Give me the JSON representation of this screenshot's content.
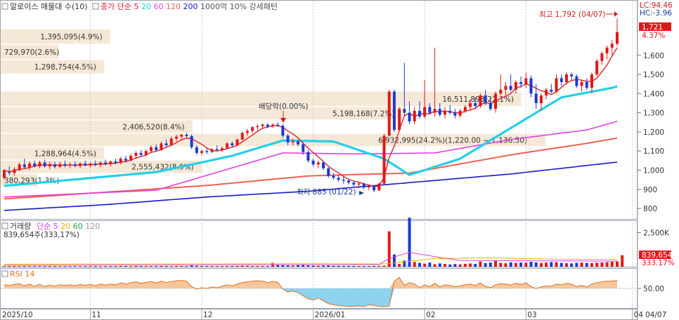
{
  "header": {
    "main_title": "알로이스 매물대 수(10)",
    "main_legend": [
      {
        "text": "종가 단순 5",
        "color": "#e0202a"
      },
      {
        "text": "20",
        "color": "#22d0e8"
      },
      {
        "text": "60",
        "color": "#e040e0"
      },
      {
        "text": "120",
        "color": "#f06050"
      },
      {
        "text": "200",
        "color": "#1818c8"
      },
      {
        "text": "1000억 10% 강세패턴",
        "color": "#555555"
      }
    ],
    "volume_title": "거래량",
    "volume_legend": [
      {
        "text": "단순 5",
        "color": "#e040e0"
      },
      {
        "text": "20",
        "color": "#e8b400"
      },
      {
        "text": "60",
        "color": "#22a040"
      },
      {
        "text": "120",
        "color": "#999999"
      }
    ],
    "volume_value": "839,654주(333,17%)",
    "rsi_title": "RSI 14"
  },
  "right_labels": {
    "lc": "LC:94.46",
    "hc": "HC:-3.96",
    "price_box": "1,721",
    "price_pct": "4.37%",
    "vol_box": "839,654",
    "vol_pct": "333.17%"
  },
  "annotations": {
    "high": "최고 1,792 (04/07)",
    "low": "최저 885 (01/22)",
    "dividend": "배당락(0.00%)"
  },
  "volume_profile": [
    {
      "label": "1,395,095(4.9%)",
      "lo": 1660,
      "hi": 1735,
      "frac": 0.18
    },
    {
      "label": "729,970(2.6%)",
      "lo": 1580,
      "hi": 1655,
      "frac": 0.095
    },
    {
      "label": "1,298,754(4.5%)",
      "lo": 1505,
      "hi": 1575,
      "frac": 0.17
    },
    {
      "label": "16,511,893(22.1%)",
      "lo": 1335,
      "hi": 1410,
      "frac": 0.855
    },
    {
      "label": "5,198,168(7.2%)",
      "lo": 1265,
      "hi": 1330,
      "frac": 0.66
    },
    {
      "label": "2,406,520(8.4%)",
      "lo": 1195,
      "hi": 1260,
      "frac": 0.315
    },
    {
      "label": "6,932,995(24.2%)(1,220.00 ~ 1,136.50)",
      "lo": 1125,
      "hi": 1190,
      "frac": 0.895
    },
    {
      "label": "1,288,964(4.5%)",
      "lo": 1055,
      "hi": 1120,
      "frac": 0.17
    },
    {
      "label": "2,555,432(8.9%)",
      "lo": 985,
      "hi": 1050,
      "frac": 0.33
    },
    {
      "label": "380,293(1.3%)",
      "lo": 915,
      "hi": 980,
      "frac": 0.06
    }
  ],
  "chart_data": {
    "type": "candlestick",
    "price_axis": {
      "ticks": [
        800,
        900,
        1000,
        1100,
        1200,
        1300,
        1400,
        1500,
        1600
      ],
      "labels": [
        "800",
        "900",
        "1,000",
        "1,100",
        "1,200",
        "1,300",
        "1,400",
        "1,500",
        "1,600"
      ],
      "range": [
        760,
        1830
      ]
    },
    "volume_axis": {
      "ticks": [
        2500000
      ],
      "labels": [
        "2,500K"
      ],
      "range": [
        0,
        3200000
      ]
    },
    "rsi_axis": {
      "ticks": [
        50
      ],
      "labels": [
        "50.00"
      ],
      "range": [
        0,
        100
      ]
    },
    "x_labels": [
      {
        "i": 0,
        "label": "2025/10"
      },
      {
        "i": 17,
        "label": "11"
      },
      {
        "i": 39,
        "label": "12"
      },
      {
        "i": 61,
        "label": "2026/01"
      },
      {
        "i": 83,
        "label": "02"
      },
      {
        "i": 103,
        "label": "03"
      },
      {
        "i": 124,
        "label": "04"
      }
    ],
    "last_x_label": "04/07",
    "candles": [
      {
        "o": 960,
        "h": 1005,
        "l": 950,
        "c": 1000
      },
      {
        "o": 990,
        "h": 1020,
        "l": 975,
        "c": 985
      },
      {
        "o": 985,
        "h": 1015,
        "l": 970,
        "c": 1005
      },
      {
        "o": 1000,
        "h": 1040,
        "l": 995,
        "c": 1030
      },
      {
        "o": 1030,
        "h": 1060,
        "l": 1010,
        "c": 1015
      },
      {
        "o": 1015,
        "h": 1045,
        "l": 1000,
        "c": 1035
      },
      {
        "o": 1035,
        "h": 1050,
        "l": 1015,
        "c": 1020
      },
      {
        "o": 1020,
        "h": 1050,
        "l": 1010,
        "c": 1040
      },
      {
        "o": 1040,
        "h": 1055,
        "l": 1015,
        "c": 1020
      },
      {
        "o": 1020,
        "h": 1045,
        "l": 1005,
        "c": 1030
      },
      {
        "o": 1030,
        "h": 1045,
        "l": 1010,
        "c": 1018
      },
      {
        "o": 1018,
        "h": 1045,
        "l": 1010,
        "c": 1032
      },
      {
        "o": 1032,
        "h": 1050,
        "l": 1015,
        "c": 1025
      },
      {
        "o": 1025,
        "h": 1040,
        "l": 1010,
        "c": 1030
      },
      {
        "o": 1030,
        "h": 1045,
        "l": 1015,
        "c": 1022
      },
      {
        "o": 1022,
        "h": 1040,
        "l": 1010,
        "c": 1035
      },
      {
        "o": 1035,
        "h": 1050,
        "l": 1020,
        "c": 1025
      },
      {
        "o": 1025,
        "h": 1040,
        "l": 1015,
        "c": 1035
      },
      {
        "o": 1035,
        "h": 1050,
        "l": 1020,
        "c": 1028
      },
      {
        "o": 1028,
        "h": 1045,
        "l": 1015,
        "c": 1040
      },
      {
        "o": 1040,
        "h": 1055,
        "l": 1025,
        "c": 1032
      },
      {
        "o": 1032,
        "h": 1050,
        "l": 1020,
        "c": 1045
      },
      {
        "o": 1045,
        "h": 1060,
        "l": 1030,
        "c": 1038
      },
      {
        "o": 1038,
        "h": 1070,
        "l": 1030,
        "c": 1060
      },
      {
        "o": 1060,
        "h": 1075,
        "l": 1040,
        "c": 1050
      },
      {
        "o": 1050,
        "h": 1085,
        "l": 1045,
        "c": 1075
      },
      {
        "o": 1075,
        "h": 1100,
        "l": 1060,
        "c": 1090
      },
      {
        "o": 1090,
        "h": 1105,
        "l": 1070,
        "c": 1080
      },
      {
        "o": 1080,
        "h": 1110,
        "l": 1070,
        "c": 1100
      },
      {
        "o": 1100,
        "h": 1130,
        "l": 1090,
        "c": 1120
      },
      {
        "o": 1120,
        "h": 1135,
        "l": 1095,
        "c": 1105
      },
      {
        "o": 1105,
        "h": 1150,
        "l": 1100,
        "c": 1140
      },
      {
        "o": 1140,
        "h": 1160,
        "l": 1120,
        "c": 1130
      },
      {
        "o": 1130,
        "h": 1175,
        "l": 1125,
        "c": 1165
      },
      {
        "o": 1165,
        "h": 1185,
        "l": 1150,
        "c": 1175
      },
      {
        "o": 1175,
        "h": 1190,
        "l": 1160,
        "c": 1185
      },
      {
        "o": 1185,
        "h": 1195,
        "l": 1170,
        "c": 1178
      },
      {
        "o": 1178,
        "h": 1188,
        "l": 1110,
        "c": 1120
      },
      {
        "o": 1120,
        "h": 1130,
        "l": 1080,
        "c": 1090
      },
      {
        "o": 1090,
        "h": 1110,
        "l": 1080,
        "c": 1100
      },
      {
        "o": 1100,
        "h": 1115,
        "l": 1085,
        "c": 1095
      },
      {
        "o": 1095,
        "h": 1115,
        "l": 1090,
        "c": 1110
      },
      {
        "o": 1110,
        "h": 1130,
        "l": 1100,
        "c": 1105
      },
      {
        "o": 1105,
        "h": 1125,
        "l": 1095,
        "c": 1115
      },
      {
        "o": 1115,
        "h": 1145,
        "l": 1110,
        "c": 1140
      },
      {
        "o": 1140,
        "h": 1150,
        "l": 1120,
        "c": 1130
      },
      {
        "o": 1130,
        "h": 1165,
        "l": 1125,
        "c": 1160
      },
      {
        "o": 1160,
        "h": 1200,
        "l": 1155,
        "c": 1195
      },
      {
        "o": 1195,
        "h": 1215,
        "l": 1180,
        "c": 1205
      },
      {
        "o": 1205,
        "h": 1230,
        "l": 1195,
        "c": 1225
      },
      {
        "o": 1225,
        "h": 1240,
        "l": 1210,
        "c": 1230
      },
      {
        "o": 1230,
        "h": 1245,
        "l": 1215,
        "c": 1238
      },
      {
        "o": 1238,
        "h": 1245,
        "l": 1220,
        "c": 1228
      },
      {
        "o": 1228,
        "h": 1245,
        "l": 1220,
        "c": 1238
      },
      {
        "o": 1238,
        "h": 1250,
        "l": 1225,
        "c": 1232
      },
      {
        "o": 1232,
        "h": 1240,
        "l": 1170,
        "c": 1180
      },
      {
        "o": 1180,
        "h": 1190,
        "l": 1130,
        "c": 1145
      },
      {
        "o": 1145,
        "h": 1165,
        "l": 1130,
        "c": 1150
      },
      {
        "o": 1150,
        "h": 1160,
        "l": 1125,
        "c": 1135
      },
      {
        "o": 1135,
        "h": 1145,
        "l": 1080,
        "c": 1095
      },
      {
        "o": 1095,
        "h": 1105,
        "l": 1040,
        "c": 1050
      },
      {
        "o": 1050,
        "h": 1060,
        "l": 1020,
        "c": 1030
      },
      {
        "o": 1030,
        "h": 1050,
        "l": 1010,
        "c": 1040
      },
      {
        "o": 1040,
        "h": 1045,
        "l": 1000,
        "c": 1010
      },
      {
        "o": 1010,
        "h": 1015,
        "l": 960,
        "c": 970
      },
      {
        "o": 970,
        "h": 985,
        "l": 950,
        "c": 960
      },
      {
        "o": 960,
        "h": 975,
        "l": 940,
        "c": 950
      },
      {
        "o": 950,
        "h": 965,
        "l": 930,
        "c": 945
      },
      {
        "o": 945,
        "h": 955,
        "l": 925,
        "c": 935
      },
      {
        "o": 935,
        "h": 945,
        "l": 915,
        "c": 925
      },
      {
        "o": 925,
        "h": 940,
        "l": 905,
        "c": 930
      },
      {
        "o": 930,
        "h": 935,
        "l": 900,
        "c": 910
      },
      {
        "o": 910,
        "h": 925,
        "l": 895,
        "c": 915
      },
      {
        "o": 915,
        "h": 920,
        "l": 885,
        "c": 895
      },
      {
        "o": 895,
        "h": 935,
        "l": 890,
        "c": 930
      },
      {
        "o": 930,
        "h": 1190,
        "l": 925,
        "c": 1180
      },
      {
        "o": 1180,
        "h": 1420,
        "l": 1175,
        "c": 1410
      },
      {
        "o": 1410,
        "h": 1420,
        "l": 1200,
        "c": 1210
      },
      {
        "o": 1210,
        "h": 1330,
        "l": 1200,
        "c": 1320
      },
      {
        "o": 1320,
        "h": 1560,
        "l": 1280,
        "c": 1300
      },
      {
        "o": 1300,
        "h": 1360,
        "l": 1240,
        "c": 1255
      },
      {
        "o": 1255,
        "h": 1330,
        "l": 1240,
        "c": 1310
      },
      {
        "o": 1310,
        "h": 1360,
        "l": 1270,
        "c": 1280
      },
      {
        "o": 1280,
        "h": 1470,
        "l": 1270,
        "c": 1330
      },
      {
        "o": 1330,
        "h": 1350,
        "l": 1290,
        "c": 1300
      },
      {
        "o": 1300,
        "h": 1640,
        "l": 1280,
        "c": 1320
      },
      {
        "o": 1320,
        "h": 1350,
        "l": 1280,
        "c": 1290
      },
      {
        "o": 1290,
        "h": 1330,
        "l": 1270,
        "c": 1310
      },
      {
        "o": 1310,
        "h": 1340,
        "l": 1290,
        "c": 1300
      },
      {
        "o": 1300,
        "h": 1320,
        "l": 1270,
        "c": 1285
      },
      {
        "o": 1285,
        "h": 1320,
        "l": 1275,
        "c": 1310
      },
      {
        "o": 1310,
        "h": 1340,
        "l": 1300,
        "c": 1330
      },
      {
        "o": 1330,
        "h": 1370,
        "l": 1310,
        "c": 1350
      },
      {
        "o": 1350,
        "h": 1380,
        "l": 1320,
        "c": 1335
      },
      {
        "o": 1335,
        "h": 1400,
        "l": 1325,
        "c": 1390
      },
      {
        "o": 1390,
        "h": 1420,
        "l": 1340,
        "c": 1350
      },
      {
        "o": 1350,
        "h": 1380,
        "l": 1310,
        "c": 1320
      },
      {
        "o": 1320,
        "h": 1410,
        "l": 1300,
        "c": 1400
      },
      {
        "o": 1400,
        "h": 1500,
        "l": 1390,
        "c": 1420
      },
      {
        "o": 1420,
        "h": 1460,
        "l": 1390,
        "c": 1440
      },
      {
        "o": 1440,
        "h": 1500,
        "l": 1410,
        "c": 1420
      },
      {
        "o": 1420,
        "h": 1470,
        "l": 1400,
        "c": 1460
      },
      {
        "o": 1460,
        "h": 1490,
        "l": 1430,
        "c": 1450
      },
      {
        "o": 1450,
        "h": 1510,
        "l": 1430,
        "c": 1480
      },
      {
        "o": 1480,
        "h": 1495,
        "l": 1380,
        "c": 1400
      },
      {
        "o": 1400,
        "h": 1450,
        "l": 1320,
        "c": 1350
      },
      {
        "o": 1350,
        "h": 1400,
        "l": 1310,
        "c": 1390
      },
      {
        "o": 1390,
        "h": 1430,
        "l": 1370,
        "c": 1420
      },
      {
        "o": 1420,
        "h": 1450,
        "l": 1400,
        "c": 1410
      },
      {
        "o": 1410,
        "h": 1500,
        "l": 1400,
        "c": 1480
      },
      {
        "o": 1480,
        "h": 1500,
        "l": 1440,
        "c": 1460
      },
      {
        "o": 1460,
        "h": 1510,
        "l": 1450,
        "c": 1500
      },
      {
        "o": 1500,
        "h": 1510,
        "l": 1470,
        "c": 1490
      },
      {
        "o": 1490,
        "h": 1500,
        "l": 1430,
        "c": 1440
      },
      {
        "o": 1440,
        "h": 1470,
        "l": 1410,
        "c": 1460
      },
      {
        "o": 1460,
        "h": 1480,
        "l": 1420,
        "c": 1430
      },
      {
        "o": 1430,
        "h": 1510,
        "l": 1400,
        "c": 1500
      },
      {
        "o": 1500,
        "h": 1580,
        "l": 1490,
        "c": 1570
      },
      {
        "o": 1570,
        "h": 1620,
        "l": 1550,
        "c": 1610
      },
      {
        "o": 1610,
        "h": 1650,
        "l": 1580,
        "c": 1640
      },
      {
        "o": 1640,
        "h": 1680,
        "l": 1600,
        "c": 1660
      },
      {
        "o": 1660,
        "h": 1792,
        "l": 1650,
        "c": 1721
      }
    ],
    "ma5_color": "#e0202a",
    "ma20": {
      "color": "#22d0e8",
      "x": [
        0,
        30,
        45,
        55,
        65,
        75,
        80,
        90,
        100,
        110,
        120,
        127
      ],
      "y": [
        918,
        990,
        1075,
        1155,
        1150,
        1060,
        975,
        1060,
        1220,
        1380,
        1430,
        1485
      ]
    },
    "ma60": {
      "color": "#e040e0",
      "x": [
        0,
        30,
        55,
        70,
        85,
        100,
        115,
        127
      ],
      "y": [
        860,
        895,
        1090,
        1085,
        1090,
        1160,
        1210,
        1300
      ]
    },
    "ma120": {
      "color": "#f06050",
      "x": [
        0,
        40,
        60,
        80,
        100,
        115,
        127
      ],
      "y": [
        850,
        920,
        970,
        985,
        1080,
        1140,
        1195
      ]
    },
    "ma200": {
      "color": "#1818c8",
      "x": [
        0,
        20,
        40,
        60,
        80,
        100,
        127
      ],
      "y": [
        790,
        820,
        860,
        890,
        935,
        980,
        1060
      ]
    },
    "volume": [
      38000,
      32000,
      40000,
      35000,
      30000,
      36000,
      34000,
      38000,
      32000,
      35000,
      30000,
      33000,
      29000,
      34000,
      31000,
      36000,
      30000,
      33000,
      37000,
      34000,
      32000,
      36000,
      35000,
      52000,
      42000,
      38000,
      60000,
      45000,
      40000,
      48000,
      42000,
      55000,
      44000,
      40000,
      50000,
      48000,
      42000,
      90000,
      62000,
      45000,
      40000,
      43000,
      38000,
      41000,
      50000,
      45000,
      55000,
      70000,
      65000,
      52000,
      48000,
      45000,
      42000,
      280000,
      160000,
      120000,
      95000,
      80000,
      110000,
      130000,
      95000,
      80000,
      72000,
      86000,
      90000,
      70000,
      64000,
      60000,
      58000,
      54000,
      50000,
      48000,
      45000,
      52000,
      55000,
      75000,
      2600000,
      900000,
      200000,
      450000,
      3600000,
      350000,
      280000,
      220000,
      300000,
      180000,
      240000,
      200000,
      160000,
      190000,
      170000,
      210000,
      230000,
      200000,
      380000,
      260000,
      300000,
      420000,
      280000,
      250000,
      320000,
      280000,
      300000,
      290000,
      360000,
      310000,
      270000,
      300000,
      340000,
      330000,
      280000,
      260000,
      240000,
      280000,
      300000,
      270000,
      260000,
      290000,
      310000,
      330000,
      360000,
      380000,
      839654
    ],
    "volume_ma5": {
      "color": "#e040e0",
      "x": [
        0,
        74,
        76,
        80,
        84,
        90,
        127
      ],
      "y": [
        100000,
        150000,
        600000,
        1050000,
        800000,
        450000,
        400000
      ]
    },
    "volume_ma20": {
      "color": "#e8b400",
      "x": [
        0,
        60,
        75,
        85,
        95,
        110,
        127
      ],
      "y": [
        180000,
        220000,
        200000,
        600000,
        650000,
        550000,
        520000
      ]
    },
    "rsi": [
      60,
      58,
      61,
      63,
      57,
      62,
      56,
      61,
      55,
      59,
      56,
      60,
      58,
      60,
      57,
      61,
      58,
      61,
      57,
      62,
      59,
      62,
      60,
      65,
      62,
      66,
      68,
      64,
      67,
      69,
      65,
      70,
      66,
      69,
      71,
      72,
      70,
      55,
      48,
      52,
      50,
      54,
      52,
      56,
      60,
      57,
      62,
      66,
      68,
      70,
      71,
      70,
      66,
      69,
      67,
      48,
      40,
      43,
      38,
      30,
      22,
      18,
      24,
      16,
      8,
      5,
      3,
      2,
      1,
      1,
      2,
      0,
      5,
      3,
      1,
      0,
      2,
      70,
      80,
      58,
      66,
      62,
      52,
      60,
      55,
      64,
      54,
      60,
      58,
      55,
      57,
      60,
      62,
      58,
      65,
      56,
      52,
      60,
      63,
      62,
      59,
      64,
      61,
      65,
      55,
      50,
      54,
      57,
      56,
      62,
      60,
      64,
      62,
      55,
      58,
      54,
      62,
      66,
      68,
      70,
      70,
      72
    ]
  }
}
